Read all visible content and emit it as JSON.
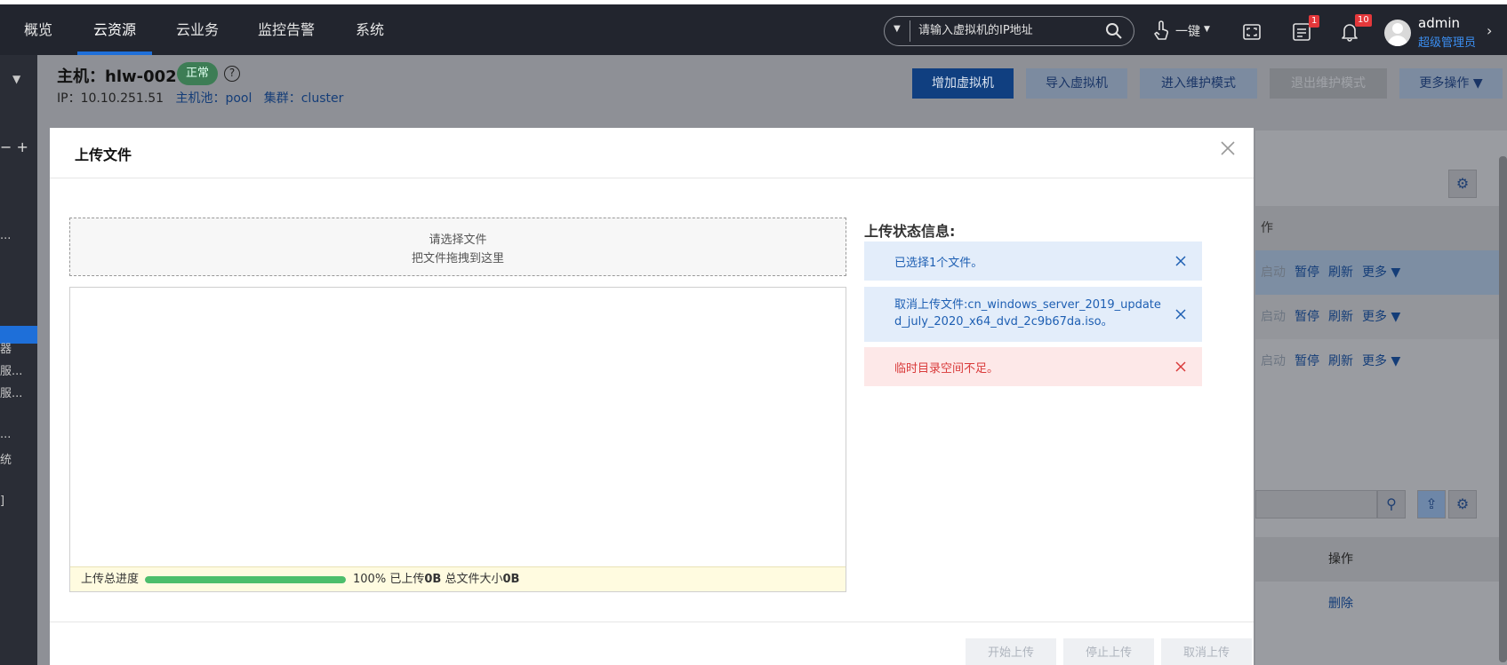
{
  "nav": {
    "items": [
      "概览",
      "云资源",
      "云业务",
      "监控告警",
      "系统"
    ],
    "active_index": 1
  },
  "search": {
    "placeholder": "请输入虚拟机的IP地址"
  },
  "toolbar": {
    "one_key_label": "一键",
    "task_badge": "1",
    "alert_badge": "10"
  },
  "user": {
    "name": "admin",
    "role": "超级管理员"
  },
  "sidebar": {
    "items": [
      "器",
      "服...",
      "服...",
      "...",
      "统",
      "]"
    ]
  },
  "host": {
    "title": "主机：hlw-002",
    "status": "正常",
    "ip_label": "IP：",
    "ip": "10.10.251.51",
    "pool_label": "主机池：",
    "pool": "pool",
    "cluster_label": "集群：",
    "cluster": "cluster"
  },
  "host_actions": {
    "add_vm": "增加虚拟机",
    "import_vm": "导入虚拟机",
    "enter_maint": "进入维护模式",
    "exit_maint": "退出维护模式",
    "more": "更多操作"
  },
  "bg_table": {
    "header": "作",
    "row_actions": [
      "启动",
      "暂停",
      "刷新",
      "更多"
    ],
    "lower_header": "操作",
    "lower_action": "删除"
  },
  "modal": {
    "title": "上传文件",
    "dropzone_line1": "请选择文件",
    "dropzone_line2": "把文件拖拽到这里",
    "progress_label": "上传总进度",
    "progress_percent": 100,
    "progress_percent_text": "100%",
    "uploaded_label": "已上传",
    "uploaded_value": "0B",
    "total_label": "总文件大小",
    "total_value": "0B",
    "status_title": "上传状态信息:",
    "messages": [
      {
        "type": "info",
        "text": "已选择1个文件。"
      },
      {
        "type": "info",
        "text": "取消上传文件:cn_windows_server_2019_updated_july_2020_x64_dvd_2c9b67da.iso。"
      },
      {
        "type": "error",
        "text": "临时目录空间不足。"
      }
    ],
    "buttons": {
      "start": "开始上传",
      "stop": "停止上传",
      "cancel": "取消上传"
    }
  },
  "colors": {
    "accent": "#1e6fd9",
    "progress": "#4cbe6b",
    "info_bg": "#e3edfa",
    "error_bg": "#fde8e8"
  }
}
